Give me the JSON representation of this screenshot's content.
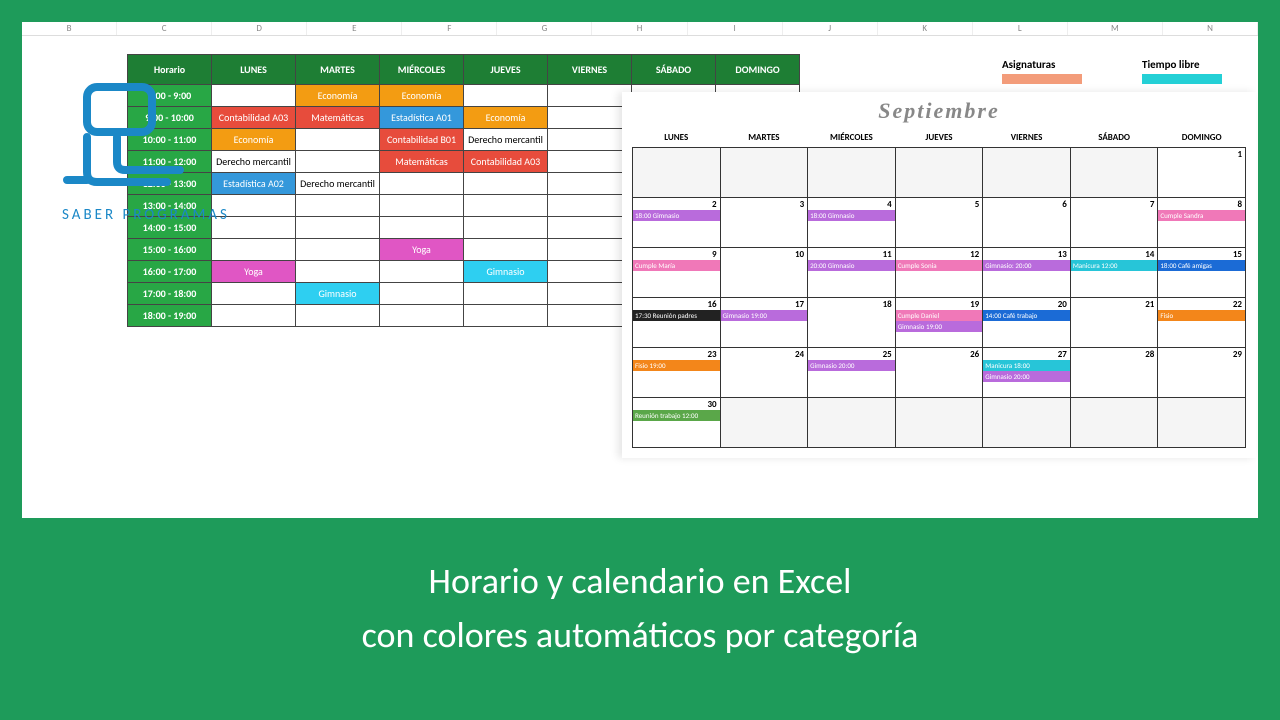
{
  "logo_text": "SABER PROGRAMAS",
  "legend": {
    "a": "Asignaturas",
    "b": "Tiempo libre"
  },
  "sched": {
    "headers": [
      "Horario",
      "LUNES",
      "MARTES",
      "MIÉRCOLES",
      "JUEVES",
      "VIERNES",
      "SÁBADO",
      "DOMINGO"
    ],
    "rows": [
      {
        "t": "8:00 - 9:00",
        "c": [
          null,
          {
            "v": "Economía",
            "k": "c-orange"
          },
          {
            "v": "Economía",
            "k": "c-orange"
          },
          null,
          null,
          null,
          null
        ]
      },
      {
        "t": "9:00 - 10:00",
        "c": [
          {
            "v": "Contabilidad A03",
            "k": "c-red"
          },
          {
            "v": "Matemáticas",
            "k": "c-red"
          },
          {
            "v": "Estadística A01",
            "k": "c-blue"
          },
          {
            "v": "Economía",
            "k": "c-orange"
          },
          null,
          null,
          null
        ]
      },
      {
        "t": "10:00 - 11:00",
        "c": [
          {
            "v": "Economía",
            "k": "c-orange"
          },
          null,
          {
            "v": "Contabilidad B01",
            "k": "c-red"
          },
          {
            "v": "Derecho mercantil",
            "k": ""
          },
          null,
          null,
          null
        ]
      },
      {
        "t": "11:00 - 12:00",
        "c": [
          {
            "v": "Derecho mercantil",
            "k": ""
          },
          null,
          {
            "v": "Matemáticas",
            "k": "c-red"
          },
          {
            "v": "Contabilidad A03",
            "k": "c-red"
          },
          null,
          null,
          null
        ]
      },
      {
        "t": "12:00 - 13:00",
        "c": [
          {
            "v": "Estadística A02",
            "k": "c-blue"
          },
          {
            "v": "Derecho mercantil",
            "k": ""
          },
          null,
          null,
          null,
          null,
          null
        ]
      },
      {
        "t": "13:00 - 14:00",
        "c": [
          null,
          null,
          null,
          null,
          null,
          null,
          null
        ]
      },
      {
        "t": "14:00 - 15:00",
        "c": [
          null,
          null,
          null,
          null,
          null,
          null,
          null
        ]
      },
      {
        "t": "15:00 - 16:00",
        "c": [
          null,
          null,
          {
            "v": "Yoga",
            "k": "c-magenta"
          },
          null,
          null,
          null,
          null
        ]
      },
      {
        "t": "16:00 - 17:00",
        "c": [
          {
            "v": "Yoga",
            "k": "c-magenta"
          },
          null,
          null,
          {
            "v": "Gimnasio",
            "k": "c-cyan"
          },
          null,
          null,
          null
        ]
      },
      {
        "t": "17:00 - 18:00",
        "c": [
          null,
          {
            "v": "Gimnasio",
            "k": "c-cyan"
          },
          null,
          null,
          null,
          null,
          null
        ]
      },
      {
        "t": "18:00 - 19:00",
        "c": [
          null,
          null,
          null,
          null,
          null,
          null,
          null
        ]
      }
    ]
  },
  "calendar": {
    "month": "Septiembre",
    "days": [
      "LUNES",
      "MARTES",
      "MIÉRCOLES",
      "JUEVES",
      "VIERNES",
      "SÁBADO",
      "DOMINGO"
    ],
    "weeks": [
      [
        null,
        null,
        null,
        null,
        null,
        null,
        {
          "n": 1
        }
      ],
      [
        {
          "n": 2,
          "e": [
            {
              "t": "18:00 Gimnasio",
              "k": "e-purple"
            }
          ]
        },
        {
          "n": 3
        },
        {
          "n": 4,
          "e": [
            {
              "t": "18:00 Gimnasio",
              "k": "e-purple"
            }
          ]
        },
        {
          "n": 5
        },
        {
          "n": 6
        },
        {
          "n": 7
        },
        {
          "n": 8,
          "e": [
            {
              "t": "Cumple Sandra",
              "k": "e-pink"
            }
          ]
        }
      ],
      [
        {
          "n": 9,
          "e": [
            {
              "t": "Cumple María",
              "k": "e-pink"
            }
          ]
        },
        {
          "n": 10
        },
        {
          "n": 11,
          "e": [
            {
              "t": "20:00 Gimnasio",
              "k": "e-purple"
            }
          ]
        },
        {
          "n": 12,
          "e": [
            {
              "t": "Cumple Sonia",
              "k": "e-pink"
            }
          ]
        },
        {
          "n": 13,
          "e": [
            {
              "t": "Gimnasio: 20:00",
              "k": "e-purple"
            }
          ]
        },
        {
          "n": 14,
          "e": [
            {
              "t": "Manicura 12:00",
              "k": "e-teal"
            }
          ]
        },
        {
          "n": 15,
          "e": [
            {
              "t": "18:00 Café amigas",
              "k": "e-dblue"
            }
          ]
        }
      ],
      [
        {
          "n": 16,
          "e": [
            {
              "t": "17:30 Reunión padres",
              "k": "e-black"
            }
          ]
        },
        {
          "n": 17,
          "e": [
            {
              "t": "Gimnasio 19:00",
              "k": "e-purple"
            }
          ]
        },
        {
          "n": 18
        },
        {
          "n": 19,
          "e": [
            {
              "t": "Cumple Daniel",
              "k": "e-pink"
            },
            {
              "t": "Gimnasio 19:00",
              "k": "e-purple"
            }
          ]
        },
        {
          "n": 20,
          "e": [
            {
              "t": "14:00 Café trabajo",
              "k": "e-dblue"
            }
          ]
        },
        {
          "n": 21
        },
        {
          "n": 22,
          "e": [
            {
              "t": "Fisio",
              "k": "e-orange"
            }
          ]
        }
      ],
      [
        {
          "n": 23,
          "e": [
            {
              "t": "Fisio 19:00",
              "k": "e-orange"
            }
          ]
        },
        {
          "n": 24
        },
        {
          "n": 25,
          "e": [
            {
              "t": "Gimnasio 20:00",
              "k": "e-purple"
            }
          ]
        },
        {
          "n": 26
        },
        {
          "n": 27,
          "e": [
            {
              "t": "Manicura 18:00",
              "k": "e-teal"
            },
            {
              "t": "Gimnasio 20:00",
              "k": "e-purple"
            }
          ]
        },
        {
          "n": 28
        },
        {
          "n": 29
        }
      ],
      [
        {
          "n": 30,
          "e": [
            {
              "t": "Reunión trabajo 12:00",
              "k": "e-green"
            }
          ]
        },
        null,
        null,
        null,
        null,
        null,
        null
      ]
    ]
  },
  "banner": {
    "l1": "Horario y calendario en Excel",
    "l2": "con colores automáticos por categoría"
  }
}
